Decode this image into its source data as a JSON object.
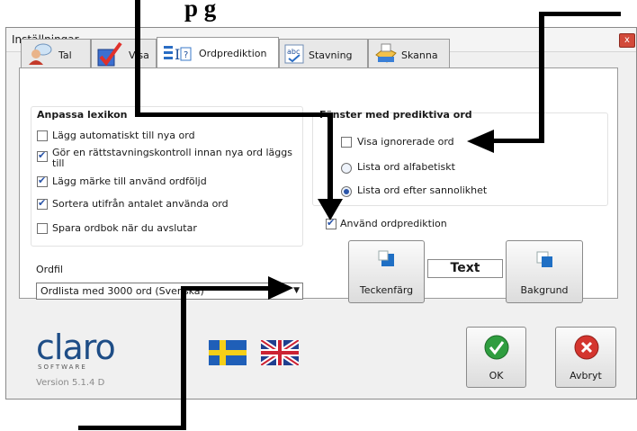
{
  "annotation": {
    "heading": "p                              g"
  },
  "window": {
    "title": "Inställningar",
    "close": "x"
  },
  "tabs": [
    {
      "label": "Tal",
      "icon": "person-speech-icon"
    },
    {
      "label": "Visa",
      "icon": "checkmark-icon"
    },
    {
      "label": "Ordprediktion",
      "icon": "word-prediction-icon",
      "active": true
    },
    {
      "label": "Stavning",
      "icon": "spelling-abc-icon"
    },
    {
      "label": "Skanna",
      "icon": "scanner-icon"
    }
  ],
  "lexicon": {
    "title": "Anpassa lexikon",
    "options": [
      {
        "label": "Lägg automatiskt till nya ord",
        "checked": false
      },
      {
        "label": "Gör en rättstavningskontroll innan nya ord läggs till",
        "checked": true
      },
      {
        "label": "Lägg märke till använd ordföljd",
        "checked": true
      },
      {
        "label": "Sortera utifrån antalet använda ord",
        "checked": true
      },
      {
        "label": "Spara ordbok när du avslutar",
        "checked": false
      }
    ]
  },
  "wordlist": {
    "label": "Ordfil",
    "value": "Ordlista med 3000 ord (Svenska)"
  },
  "prediction_window": {
    "title": "Fönster med prediktiva ord",
    "show_ignored": {
      "label": "Visa ignorerade ord",
      "checked": false
    },
    "radios": [
      {
        "label": "Lista ord alfabetiskt",
        "selected": false
      },
      {
        "label": "Lista ord efter sannolikhet",
        "selected": true
      }
    ]
  },
  "use_prediction": {
    "label": "Använd ordprediktion",
    "checked": true
  },
  "colors": {
    "text_sample": "Text",
    "text_color_button": "Teckenfärg",
    "background_button": "Bakgrund",
    "swatch": "#1f6fc4"
  },
  "footer": {
    "brand": "claro",
    "brand_sub": "SOFTWARE",
    "version": "Version 5.1.4 D",
    "ok": "OK",
    "cancel": "Avbryt"
  }
}
